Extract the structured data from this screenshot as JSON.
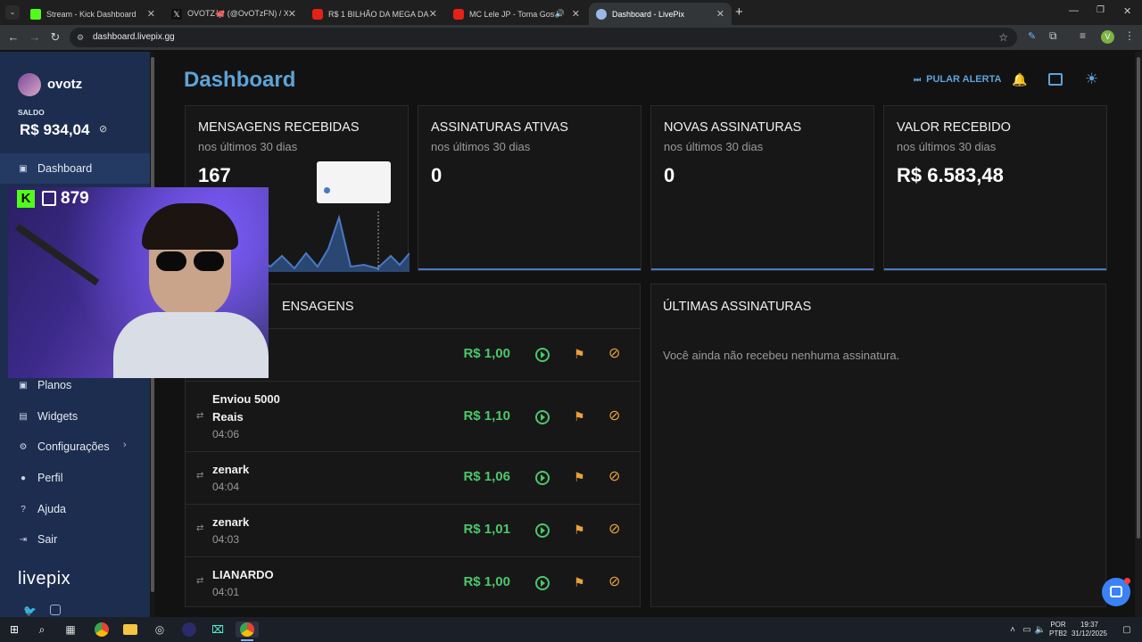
{
  "browser": {
    "tabs": [
      {
        "title": "Stream - Kick Dashboard",
        "favicon_color": "#53fc18",
        "active": false
      },
      {
        "title": "OVOTZ🐙 (@OvOTzFN) / X",
        "favicon_color": "#000000",
        "active": false
      },
      {
        "title": "R$ 1 BILHÃO DA MEGA DA VIRA",
        "favicon_color": "#ff0000",
        "active": false
      },
      {
        "title": "MC Lele JP - Toma Gostoso",
        "favicon_color": "#ff0000",
        "active": false
      },
      {
        "title": "Dashboard - LivePix",
        "favicon_color": "#9bb8e6",
        "active": true
      }
    ],
    "new_tab": "+",
    "url": "dashboard.livepix.gg",
    "profile_initial": "V"
  },
  "sidebar": {
    "username": "ovotz",
    "balance_label": "SALDO",
    "balance_value": "R$ 934,04",
    "items": [
      {
        "label": "Dashboard",
        "icon": "dashboard-icon",
        "glyph": "▣"
      },
      {
        "label": "Planos",
        "icon": "plans-icon",
        "glyph": "▣"
      },
      {
        "label": "Widgets",
        "icon": "widgets-icon",
        "glyph": "▤"
      },
      {
        "label": "Configurações",
        "icon": "settings-icon",
        "glyph": "⚙",
        "chevron": "›"
      },
      {
        "label": "Perfil",
        "icon": "profile-icon",
        "glyph": "●"
      },
      {
        "label": "Ajuda",
        "icon": "help-icon",
        "glyph": "?"
      },
      {
        "label": "Sair",
        "icon": "logout-icon",
        "glyph": "⇥"
      }
    ],
    "logo": "livepix"
  },
  "header": {
    "title": "Dashboard",
    "skip_alert": "PULAR ALERTA"
  },
  "stats": [
    {
      "title": "MENSAGENS RECEBIDAS",
      "subtitle": "nos últimos 30 dias",
      "value": "167"
    },
    {
      "title": "ASSINATURAS ATIVAS",
      "subtitle": "nos últimos 30 dias",
      "value": "0"
    },
    {
      "title": "NOVAS ASSINATURAS",
      "subtitle": "nos últimos 30 dias",
      "value": "0"
    },
    {
      "title": "VALOR RECEBIDO",
      "subtitle": "nos últimos 30 dias",
      "value": "R$ 6.583,48"
    }
  ],
  "messages": {
    "title_visible": "ENSAGENS",
    "rows": [
      {
        "name": "",
        "time": "",
        "amount": "R$ 1,00"
      },
      {
        "name": "Enviou 5000 Reais",
        "time": "04:06",
        "amount": "R$ 1,10"
      },
      {
        "name": "zenark",
        "time": "04:04",
        "amount": "R$ 1,06"
      },
      {
        "name": "zenark",
        "time": "04:03",
        "amount": "R$ 1,01"
      },
      {
        "name": "LIANARDO",
        "time": "04:01",
        "amount": "R$ 1,00"
      }
    ]
  },
  "subscriptions": {
    "title": "ÚLTIMAS ASSINATURAS",
    "empty": "Você ainda não recebeu nenhuma assinatura."
  },
  "overlay": {
    "count": "879"
  },
  "taskbar": {
    "lang": "POR",
    "layout": "PTB2",
    "time": "19:37",
    "date": "31/12/2025"
  },
  "colors": {
    "accent_blue": "#5ea3d6",
    "green": "#4cc76a",
    "orange": "#e9a23b"
  }
}
